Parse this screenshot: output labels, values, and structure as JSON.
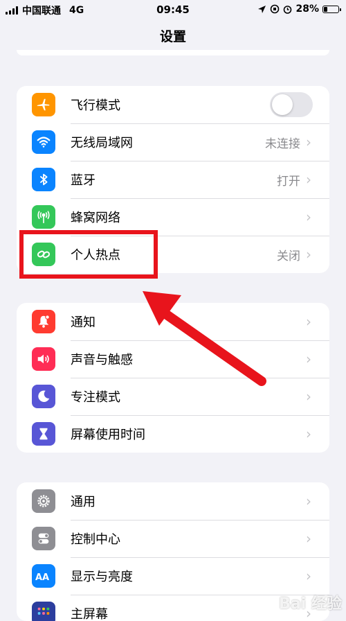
{
  "status_bar": {
    "carrier": "中国联通",
    "network": "4G",
    "time": "09:45",
    "battery": "28%",
    "battery_level": 0.28
  },
  "header": {
    "title": "设置"
  },
  "groups": [
    {
      "items": [
        {
          "label": "飞行模式",
          "icon": "airplane-icon",
          "color": "#ff9500",
          "control": "toggle",
          "toggle_on": false
        },
        {
          "label": "无线局域网",
          "icon": "wifi-icon",
          "color": "#0a84ff",
          "value": "未连接"
        },
        {
          "label": "蓝牙",
          "icon": "bluetooth-icon",
          "color": "#0a84ff",
          "value": "打开"
        },
        {
          "label": "蜂窝网络",
          "icon": "cellular-antenna-icon",
          "color": "#34c759",
          "value": ""
        },
        {
          "label": "个人热点",
          "icon": "hotspot-link-icon",
          "color": "#34c759",
          "value": "关闭"
        }
      ]
    },
    {
      "items": [
        {
          "label": "通知",
          "icon": "bell-icon",
          "color": "#ff3b30"
        },
        {
          "label": "声音与触感",
          "icon": "speaker-icon",
          "color": "#ff2d55"
        },
        {
          "label": "专注模式",
          "icon": "moon-icon",
          "color": "#5856d6"
        },
        {
          "label": "屏幕使用时间",
          "icon": "hourglass-icon",
          "color": "#5856d6"
        }
      ]
    },
    {
      "items": [
        {
          "label": "通用",
          "icon": "gear-icon",
          "color": "#8e8e93"
        },
        {
          "label": "控制中心",
          "icon": "toggles-icon",
          "color": "#8e8e93"
        },
        {
          "label": "显示与亮度",
          "icon": "text-size-icon",
          "color": "#0a84ff"
        },
        {
          "label": "主屏幕",
          "icon": "home-grid-icon",
          "color": "#2c3e9e"
        }
      ]
    }
  ],
  "annotation": {
    "highlight_color": "#e8141c"
  },
  "watermark": {
    "text": "Bai 经验"
  }
}
